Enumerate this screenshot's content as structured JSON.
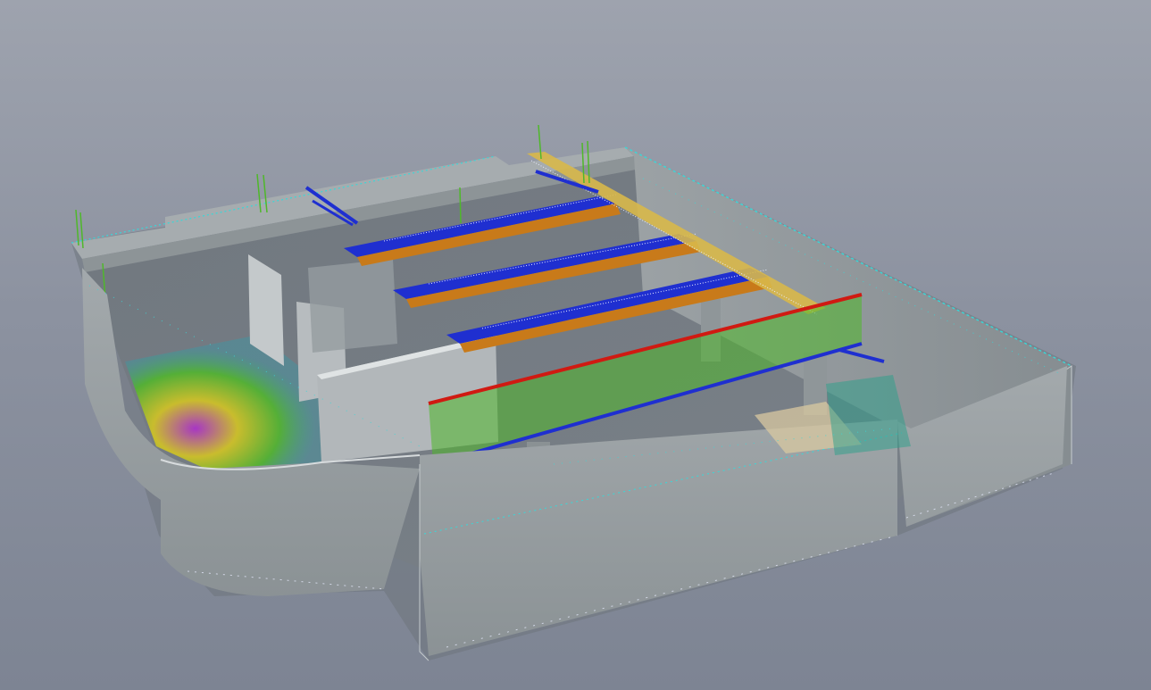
{
  "viewport": {
    "background_top": "#9ea3ae",
    "background_bottom": "#7d8493"
  },
  "model": {
    "concrete_color": "#9aa0a3",
    "concrete_dark": "#7f868a",
    "concrete_light": "#b9bfc1",
    "rebar_colors": {
      "blue": "#1f2fd0",
      "orange": "#c87a1a",
      "yellow": "#d8c81e",
      "green": "#4fb82a",
      "cyan": "#38d8d8",
      "red": "#d01a12",
      "magenta": "#b02ad0",
      "white": "#e8ecff"
    }
  }
}
